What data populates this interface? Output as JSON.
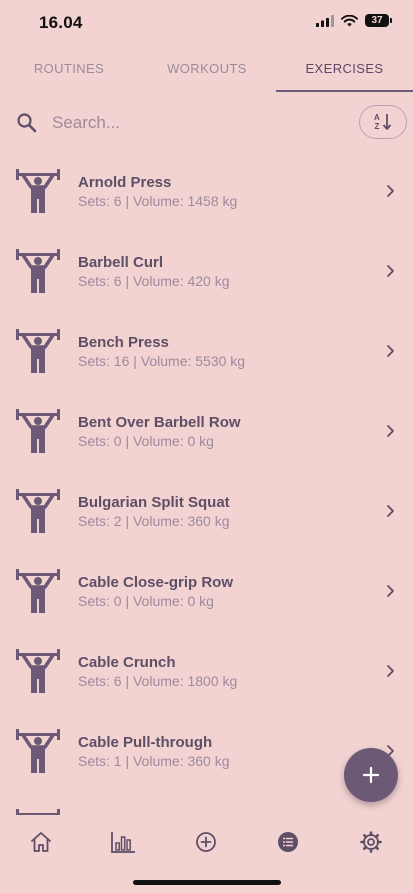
{
  "status_bar": {
    "time": "16.04",
    "battery": "37"
  },
  "tabs": [
    {
      "label": "ROUTINES"
    },
    {
      "label": "WORKOUTS"
    },
    {
      "label": "EXERCISES"
    }
  ],
  "search": {
    "placeholder": "Search...",
    "value": ""
  },
  "exercises": [
    {
      "name": "Arnold Press",
      "details": "Sets: 6 | Volume: 1458 kg"
    },
    {
      "name": "Barbell Curl",
      "details": "Sets: 6 | Volume: 420 kg"
    },
    {
      "name": "Bench Press",
      "details": "Sets: 16 | Volume: 5530 kg"
    },
    {
      "name": "Bent Over Barbell Row",
      "details": "Sets: 0 | Volume: 0 kg"
    },
    {
      "name": "Bulgarian Split Squat",
      "details": "Sets: 2 | Volume: 360 kg"
    },
    {
      "name": "Cable Close-grip Row",
      "details": "Sets: 0 | Volume: 0 kg"
    },
    {
      "name": "Cable Crunch",
      "details": "Sets: 6 | Volume: 1800 kg"
    },
    {
      "name": "Cable Pull-through",
      "details": "Sets: 1 | Volume: 360 kg"
    },
    {
      "name": "",
      "details": ""
    }
  ],
  "bottom_nav": [
    "home-icon",
    "bar-chart-icon",
    "add-circle-icon",
    "list-icon",
    "gear-icon"
  ],
  "colors": {
    "background": "#f2d3d1",
    "accent": "#6b5975",
    "text": "#5e4f67",
    "muted": "#9c8a9d"
  }
}
